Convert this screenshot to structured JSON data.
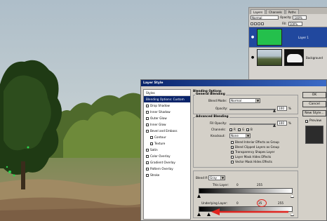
{
  "layers_palette": {
    "tabs": [
      "Layers",
      "Channels",
      "Paths"
    ],
    "blend_mode": "Normal",
    "opacity_label": "Opacity:",
    "opacity_value": "100%",
    "fill_label": "Fill:",
    "fill_value": "100%",
    "layers": [
      {
        "name": "Layer 1",
        "selected": true
      },
      {
        "name": "Background",
        "selected": false
      }
    ]
  },
  "dialog": {
    "title": "Layer Style",
    "styles_list": [
      {
        "label": "Styles",
        "header": true
      },
      {
        "label": "Blending Options: Custom",
        "selected": true
      },
      {
        "label": "Drop Shadow"
      },
      {
        "label": "Inner Shadow"
      },
      {
        "label": "Outer Glow"
      },
      {
        "label": "Inner Glow"
      },
      {
        "label": "Bevel and Emboss"
      },
      {
        "label": "Contour",
        "indent": true
      },
      {
        "label": "Texture",
        "indent": true
      },
      {
        "label": "Satin"
      },
      {
        "label": "Color Overlay"
      },
      {
        "label": "Gradient Overlay"
      },
      {
        "label": "Pattern Overlay"
      },
      {
        "label": "Stroke"
      }
    ],
    "blending": {
      "section_title": "Blending Options",
      "general_title": "General Blending",
      "blend_mode_label": "Blend Mode:",
      "blend_mode_value": "Normal",
      "opacity_label": "Opacity:",
      "opacity_value": "100",
      "opacity_unit": "%",
      "advanced_title": "Advanced Blending",
      "fill_opacity_label": "Fill Opacity:",
      "fill_opacity_value": "100",
      "fill_opacity_unit": "%",
      "channels_label": "Channels:",
      "channels": [
        "R",
        "G",
        "B"
      ],
      "knockout_label": "Knockout:",
      "knockout_value": "None",
      "options": [
        {
          "label": "Blend Interior Effects as Group",
          "checked": false
        },
        {
          "label": "Blend Clipped Layers as Group",
          "checked": true
        },
        {
          "label": "Transparency Shapes Layer",
          "checked": true
        },
        {
          "label": "Layer Mask Hides Effects",
          "checked": false
        },
        {
          "label": "Vector Mask Hides Effects",
          "checked": false
        }
      ],
      "blend_if_label": "Blend If:",
      "blend_if_value": "Gray",
      "this_layer_label": "This Layer:",
      "this_layer_min": "0",
      "this_layer_max": "255",
      "underlying_label": "Underlying Layer:",
      "underlying_min": "0",
      "underlying_max": "255",
      "underlying_split": "35"
    },
    "buttons": {
      "ok": "OK",
      "cancel": "Cancel",
      "new_style": "New Style...",
      "preview": "Preview"
    }
  },
  "colors": {
    "layer_fill": "#24c04c",
    "selection_blue": "#0a246a",
    "annotation_red": "#e0251f"
  }
}
